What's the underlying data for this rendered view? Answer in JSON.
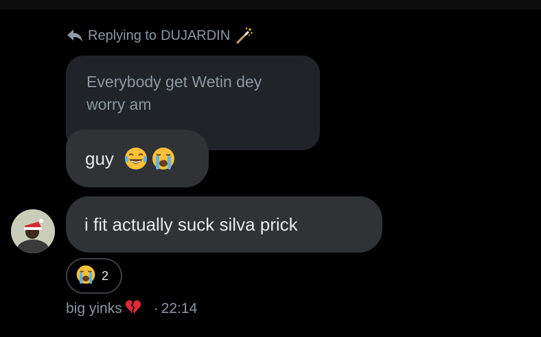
{
  "reply": {
    "prefix": "Replying to",
    "name": "DUJARDIN",
    "arrow_icon": "reply-arrow-icon",
    "wand_icon": "magic-wand-icon"
  },
  "quoted_message": {
    "text": "Everybody get Wetin dey\nworry am"
  },
  "messages": [
    {
      "text": "guy",
      "emojis": [
        "face-with-tears-of-joy",
        "loudly-crying-face"
      ]
    },
    {
      "text": "i fit actually suck silva prick"
    }
  ],
  "reaction": {
    "emoji": "loudly-crying-face",
    "count": "2"
  },
  "meta": {
    "sender": "big yinks",
    "sender_emoji": "broken-heart",
    "separator": "·",
    "time": "22:14"
  },
  "colors": {
    "background": "#000000",
    "bubble": "#2f3336",
    "quoted_bubble": "#202327",
    "muted_text": "#8b98a5",
    "text": "#e7e9ea"
  }
}
